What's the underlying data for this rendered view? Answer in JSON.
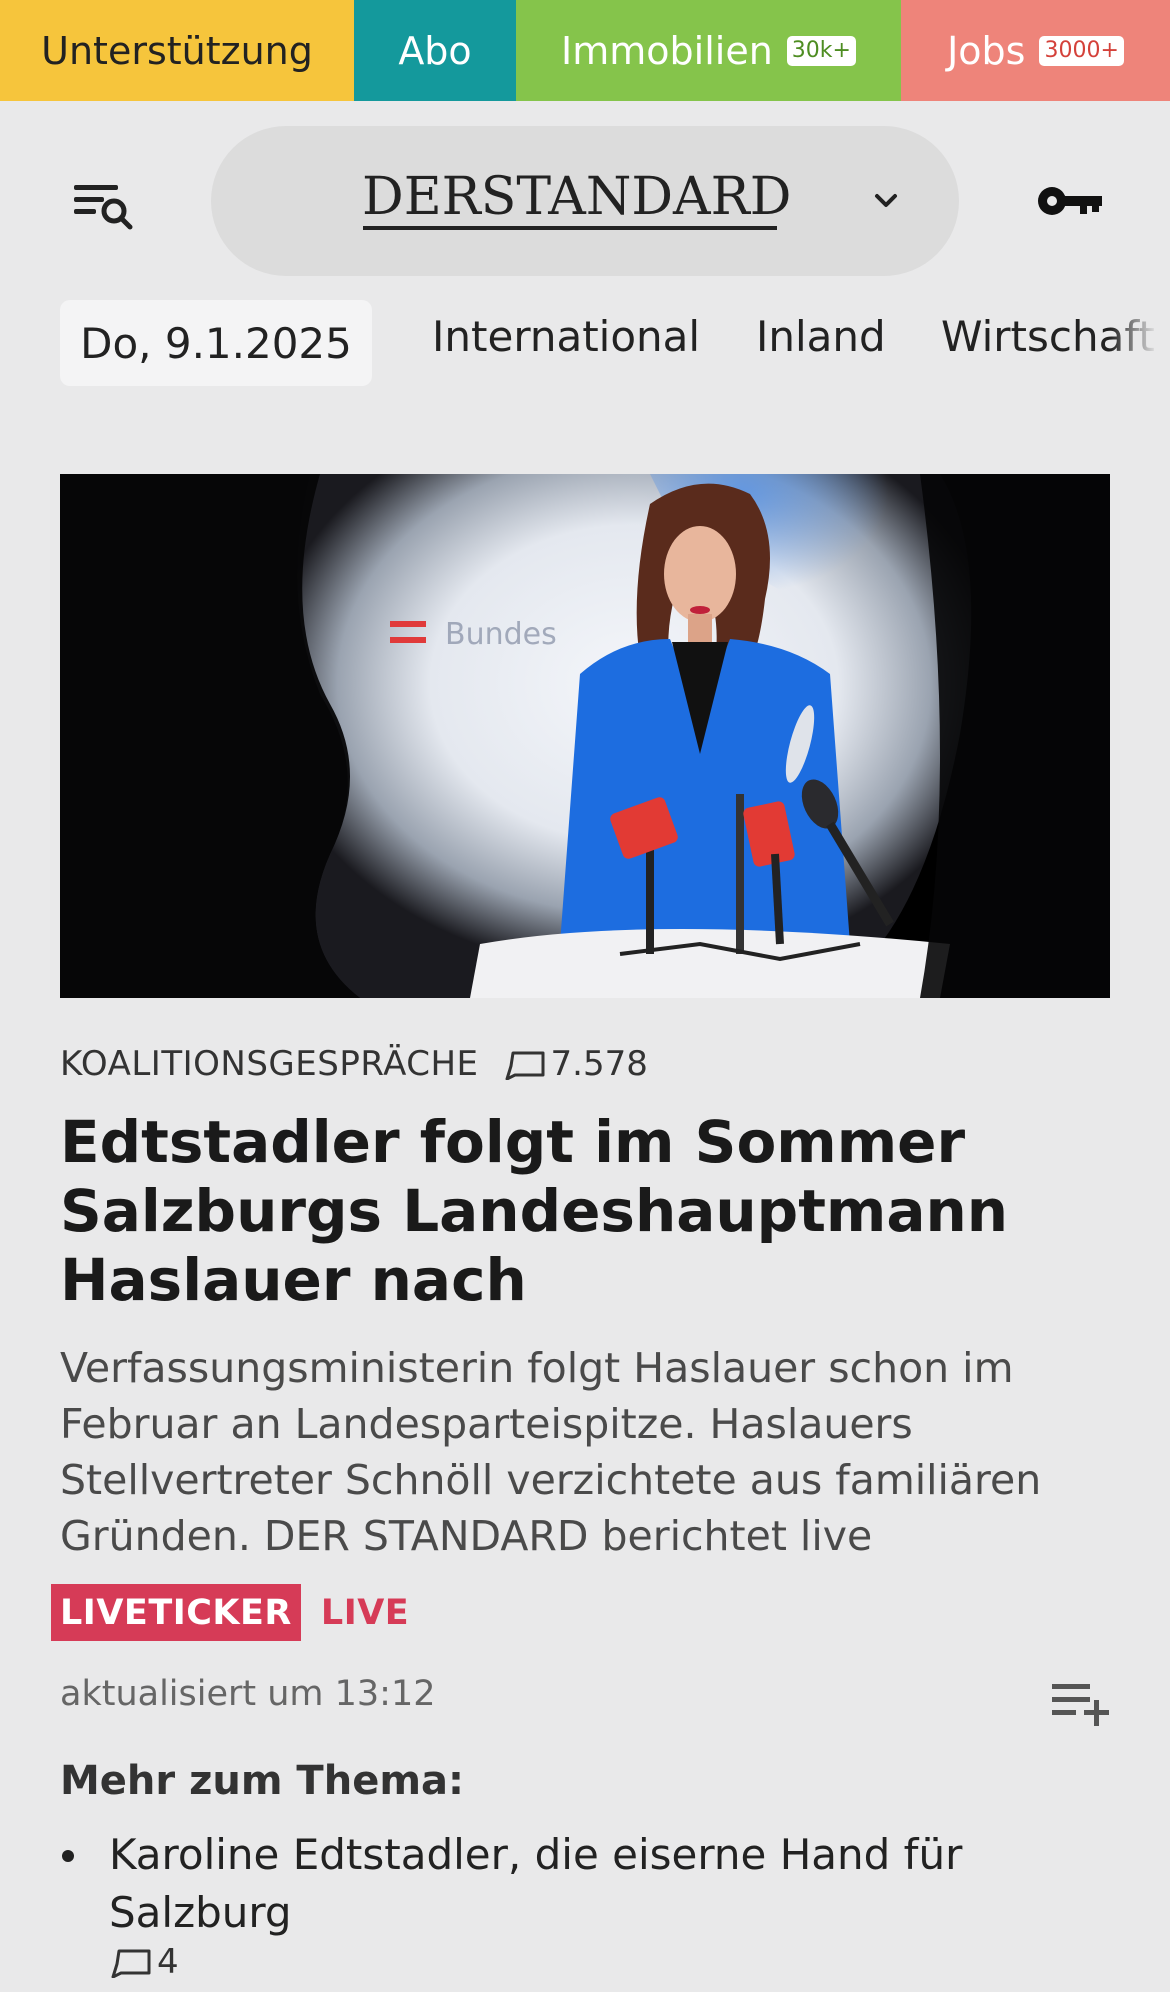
{
  "top_tabs": [
    {
      "label": "Unterstützung",
      "count": "",
      "color": "#f6c53c"
    },
    {
      "label": "Abo",
      "count": "",
      "color": "#14999c"
    },
    {
      "label": "Immobilien",
      "count": "30k+",
      "color": "#85c44b"
    },
    {
      "label": "Jobs",
      "count": "3000+",
      "color": "#ee847a"
    }
  ],
  "header": {
    "brand": "DERSTANDARD",
    "menu_icon": "menu-search-icon",
    "dropdown_icon": "chevron-down-icon",
    "account_icon": "key-icon"
  },
  "nav": {
    "date": "Do, 9.1.2025",
    "items": [
      "International",
      "Inland",
      "Wirtschaft"
    ]
  },
  "article": {
    "image_alt": "Person in blauem Blazer vor Mikrofonen bei einer Pressekonferenz",
    "image_bg_text": "Bundes",
    "kicker": "KOALITIONSGESPRÄCHE",
    "comment_count": "7.578",
    "headline": "Edtstadler folgt im Sommer Salzburgs Landeshauptmann Haslauer nach",
    "lead": "Verfassungsministerin folgt Haslauer schon im Februar an Landesparteispitze. Haslauers Stellvertreter Schnöll verzichtete aus familiären Gründen. DER STANDARD berichtet live",
    "badge": "LIVETICKER",
    "live_label": "LIVE",
    "updated": "aktualisiert um 13:12",
    "accent_color": "#d63b57"
  },
  "more": {
    "title": "Mehr zum Thema:",
    "items": [
      {
        "label": "Karoline Edtstadler, die eiserne Hand für Salzburg",
        "comments": "4"
      }
    ]
  }
}
